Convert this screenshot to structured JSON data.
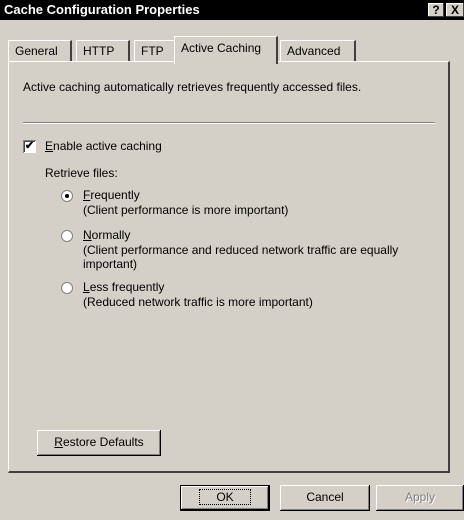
{
  "window": {
    "title": "Cache Configuration Properties",
    "help_label": "?",
    "close_label": "X"
  },
  "tabs": [
    {
      "label": "General"
    },
    {
      "label": "HTTP"
    },
    {
      "label": "FTP"
    },
    {
      "label": "Active Caching",
      "active": true
    },
    {
      "label": "Advanced"
    }
  ],
  "panel": {
    "description": "Active caching automatically retrieves frequently accessed files.",
    "enable_checkbox": {
      "label_first": "E",
      "label_rest": "nable active caching",
      "checked": true,
      "glyph": "✔"
    },
    "retrieve_label": "Retrieve files:",
    "options": [
      {
        "label_first": "F",
        "label_rest": "requently",
        "sub": [
          "(Client performance is more important)"
        ],
        "selected": true
      },
      {
        "label_first": "N",
        "label_rest": "ormally",
        "sub": [
          "(Client performance and reduced network traffic are equally",
          "important)"
        ],
        "selected": false
      },
      {
        "label_first": "L",
        "label_rest": "ess frequently",
        "sub": [
          "(Reduced network traffic is more important)"
        ],
        "selected": false
      }
    ],
    "restore_first": "R",
    "restore_rest": "estore Defaults"
  },
  "buttons": {
    "ok": "OK",
    "cancel": "Cancel",
    "apply": "Apply"
  }
}
